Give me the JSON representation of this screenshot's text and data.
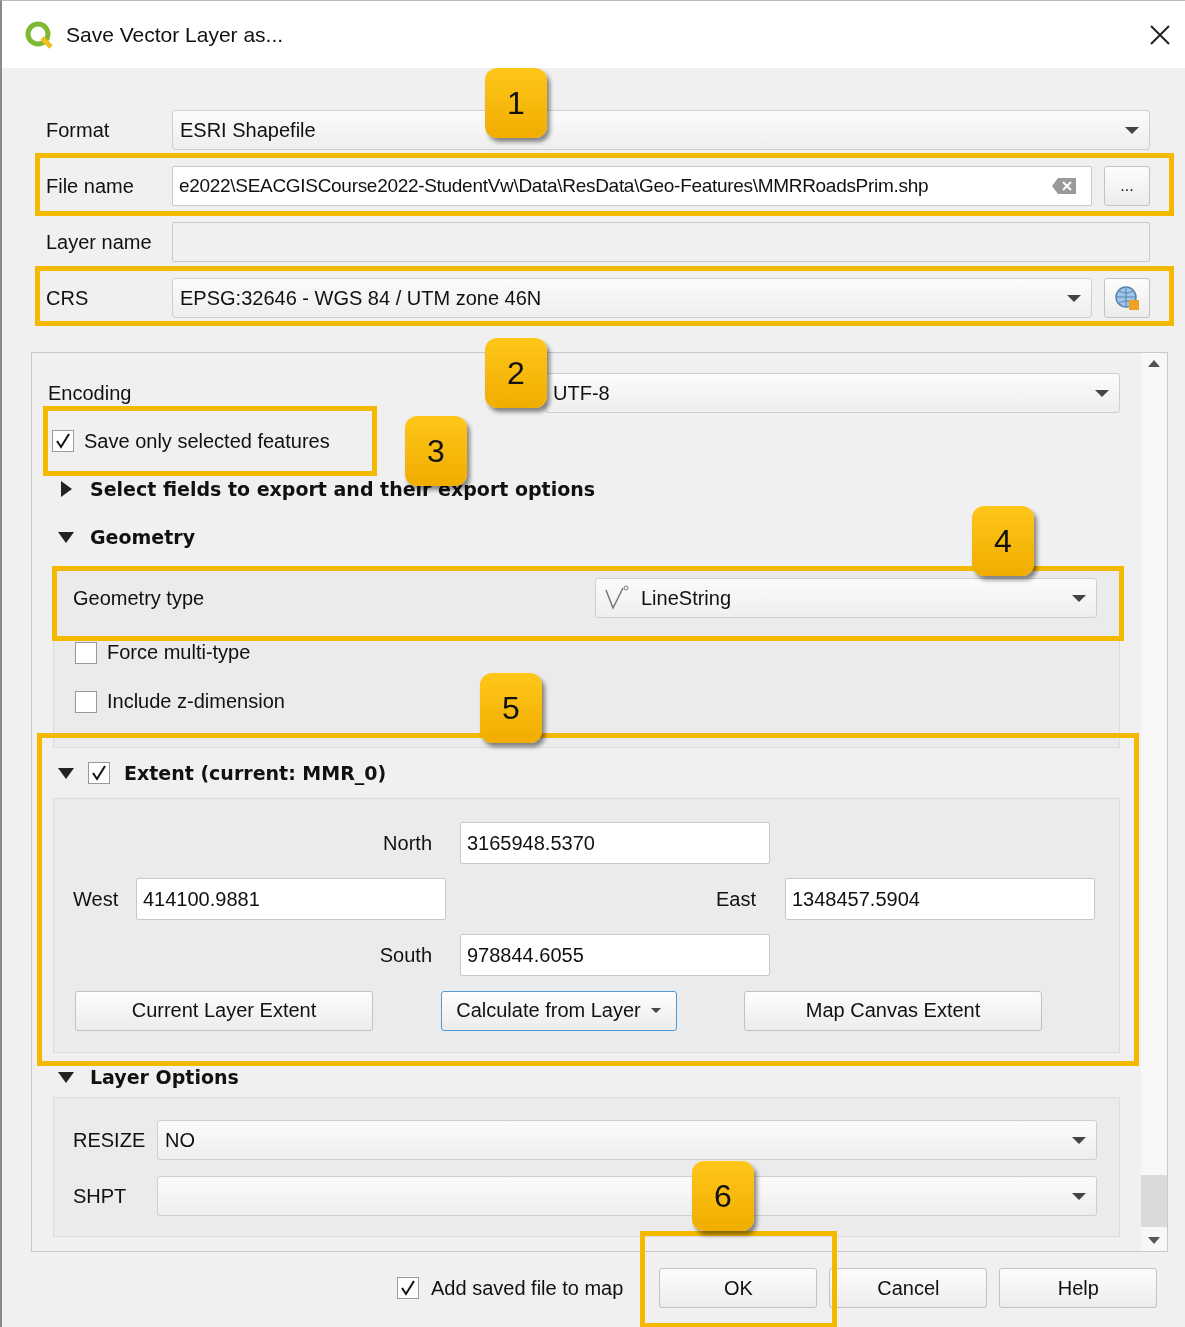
{
  "window": {
    "title": "Save Vector Layer as..."
  },
  "form": [
    {
      "kind": "combo",
      "label": "Format",
      "value": "ESRI Shapefile"
    },
    {
      "kind": "file",
      "label": "File name",
      "value": "e2022\\SEACGISCourse2022-StudentVw\\Data\\ResData\\Geo-Features\\MMRRoadsPrim.shp",
      "browse": "..."
    },
    {
      "kind": "text",
      "label": "Layer name"
    },
    {
      "kind": "crs",
      "label": "CRS",
      "value": "EPSG:32646 - WGS 84 / UTM zone 46N"
    }
  ],
  "encoding": {
    "label": "Encoding",
    "value": "UTF-8"
  },
  "save_selected": {
    "label": "Save only selected features",
    "checked": true
  },
  "sections": [
    {
      "kind": "fields",
      "title": "Select fields to export and their export options",
      "expanded": false
    },
    {
      "kind": "geometry",
      "title": "Geometry",
      "expanded": true
    },
    {
      "kind": "extent",
      "title": "Extent (current: MMR_0)",
      "expanded": true,
      "checked": true
    },
    {
      "kind": "layer_options",
      "title": "Layer Options",
      "expanded": true
    }
  ],
  "geometry": {
    "type_label": "Geometry type",
    "type_value": "LineString",
    "options": [
      {
        "label": "Force multi-type",
        "checked": false
      },
      {
        "label": "Include z-dimension",
        "checked": false
      }
    ]
  },
  "extent": {
    "north": {
      "label": "North",
      "value": "3165948.5370"
    },
    "west": {
      "label": "West",
      "value": "414100.9881"
    },
    "east": {
      "label": "East",
      "value": "1348457.5904"
    },
    "south": {
      "label": "South",
      "value": "978844.6055"
    },
    "buttons": [
      {
        "label": "Current Layer Extent",
        "kind": "plain"
      },
      {
        "label": "Calculate from Layer",
        "kind": "menu"
      },
      {
        "label": "Map Canvas Extent",
        "kind": "plain"
      }
    ]
  },
  "layer_options": [
    {
      "label": "RESIZE",
      "value": "NO"
    },
    {
      "label": "SHPT"
    }
  ],
  "footer": {
    "add_to_map": {
      "label": "Add saved file to map",
      "checked": true
    },
    "buttons": [
      "OK",
      "Cancel",
      "Help"
    ]
  },
  "callouts": [
    "1",
    "2",
    "3",
    "4",
    "5",
    "6"
  ]
}
